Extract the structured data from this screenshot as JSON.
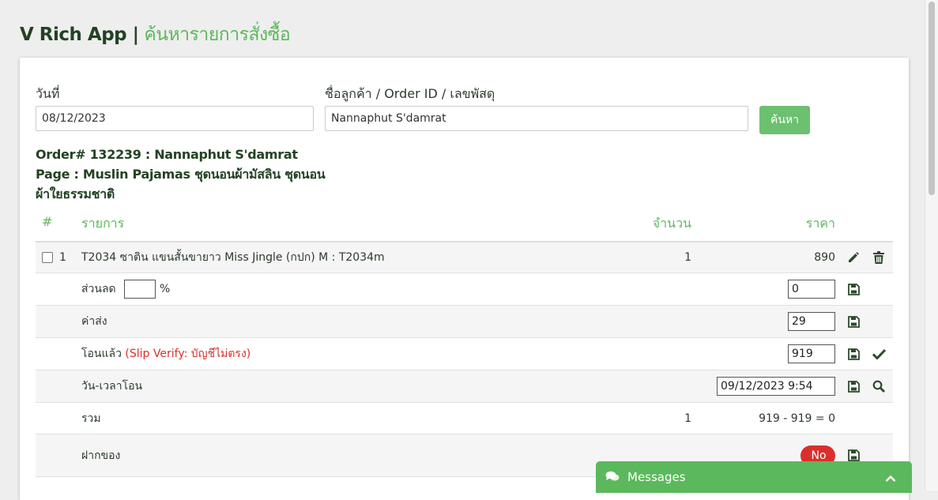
{
  "header": {
    "app_name": "V Rich App |",
    "page_title": "ค้นหารายการสั่งซื้อ"
  },
  "search": {
    "date_label": "วันที่",
    "date_value": "08/12/2023",
    "query_label": "ชื่อลูกค้า / Order ID / เลขพัสดุ",
    "query_value": "Nannaphut S'damrat",
    "button_label": "ค้นหา"
  },
  "order": {
    "order_line": "Order# 132239 : Nannaphut S'damrat",
    "page_line": "Page : Muslin Pajamas ชุดนอนผ้ามัสลิน ชุดนอน ผ้าใยธรรมชาติ"
  },
  "table": {
    "headers": {
      "num": "#",
      "item": "รายการ",
      "qty": "จำนวน",
      "price": "ราคา"
    },
    "items": [
      {
        "index": "1",
        "name": "T2034 ซาติน แขนสั้นขายาว Miss Jingle (กปก) M : T2034m",
        "qty": "1",
        "price": "890"
      }
    ],
    "discount": {
      "label": "ส่วนลด",
      "percent_value": "",
      "percent_sign": "%",
      "value": "0"
    },
    "shipping": {
      "label": "ค่าส่ง",
      "value": "29"
    },
    "paid": {
      "label": "โอนแล้ว",
      "note": "(Slip Verify: บัญชีไม่ตรง)",
      "value": "919"
    },
    "transfer_time": {
      "label": "วัน-เวลาโอน",
      "value": "09/12/2023 9:54"
    },
    "total": {
      "label": "รวม",
      "qty": "1",
      "summary": "919 - 919 = 0"
    },
    "deposit": {
      "label": "ฝากของ",
      "toggle_label": "No"
    }
  },
  "messages": {
    "label": "Messages"
  },
  "colors": {
    "accent": "#5cb85c",
    "dark_green": "#234223",
    "danger": "#d9302c",
    "button": "#6cc070"
  }
}
